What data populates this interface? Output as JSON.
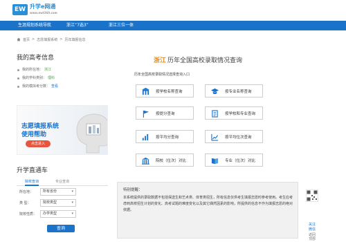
{
  "logo": {
    "mark": "EW",
    "text": "升学e网通",
    "sub": "www.ewt360.com"
  },
  "nav": {
    "items": [
      "生涯规划系统导航",
      "浙江“7选3”",
      "浙江三位一体"
    ]
  },
  "breadcrumb": {
    "items": [
      "首页",
      "志愿填报系统",
      "历年填报信息"
    ],
    "sep": ">"
  },
  "my_info": {
    "title": "我的高考信息",
    "rows": [
      {
        "label": "我的所在地：",
        "value": "浙江"
      },
      {
        "label": "我的学科类别：",
        "value": "理科"
      },
      {
        "label": "我的模拟考分数：",
        "value": "查看"
      }
    ]
  },
  "banner": {
    "line1": "志愿填报系统",
    "line2": "使用帮助",
    "button": "点击进入"
  },
  "zhitong": {
    "title": "升学直通车",
    "tabs": [
      "院校查询",
      "专业查询"
    ],
    "fields": [
      {
        "label": "所在地：",
        "value": "所有省份"
      },
      {
        "label": "类   型：",
        "value": "院校类型"
      },
      {
        "label": "院校性质：",
        "value": "办学类型"
      }
    ],
    "submit": "查询"
  },
  "main": {
    "province": "浙江",
    "title": "历年全国高校录取情况查询",
    "subtitle": "历年全国高校录取情况选择查询入口",
    "buttons": [
      {
        "label": "按学校名称查询",
        "icon": "school-building-icon"
      },
      {
        "label": "按专业名称查询",
        "icon": "graduation-cap-icon"
      },
      {
        "label": "按提分查询",
        "icon": "flag-icon"
      },
      {
        "label": "按学校和专业查询",
        "icon": "document-list-icon"
      },
      {
        "label": "按平均分查询",
        "icon": "bar-chart-icon"
      },
      {
        "label": "按平均位次查询",
        "icon": "trend-chart-icon"
      },
      {
        "label": "院校（位次）对比",
        "icon": "building-compare-icon"
      },
      {
        "label": "专业（位次）对比",
        "icon": "book-compare-icon"
      }
    ]
  },
  "notice": {
    "title": "特别提醒：",
    "text": "本系统提供的录取数据不包括保送生和艺术类、体育类招生，所有信息仅供考生填报志愿时参考使用。考生应考虑到高校招生计划的变化、高考试题的难度变化以及其它偶然因素的影响，所提供的信息不作为填报志愿的绝对依据。"
  },
  "side": {
    "links": [
      "关注",
      "微信",
      "返回",
      "顶部"
    ]
  },
  "colors": {
    "nav_blue": "#1a73c9",
    "accent_orange": "#f08a00",
    "green": "#4aa34a",
    "banner_red": "#e8553f"
  }
}
